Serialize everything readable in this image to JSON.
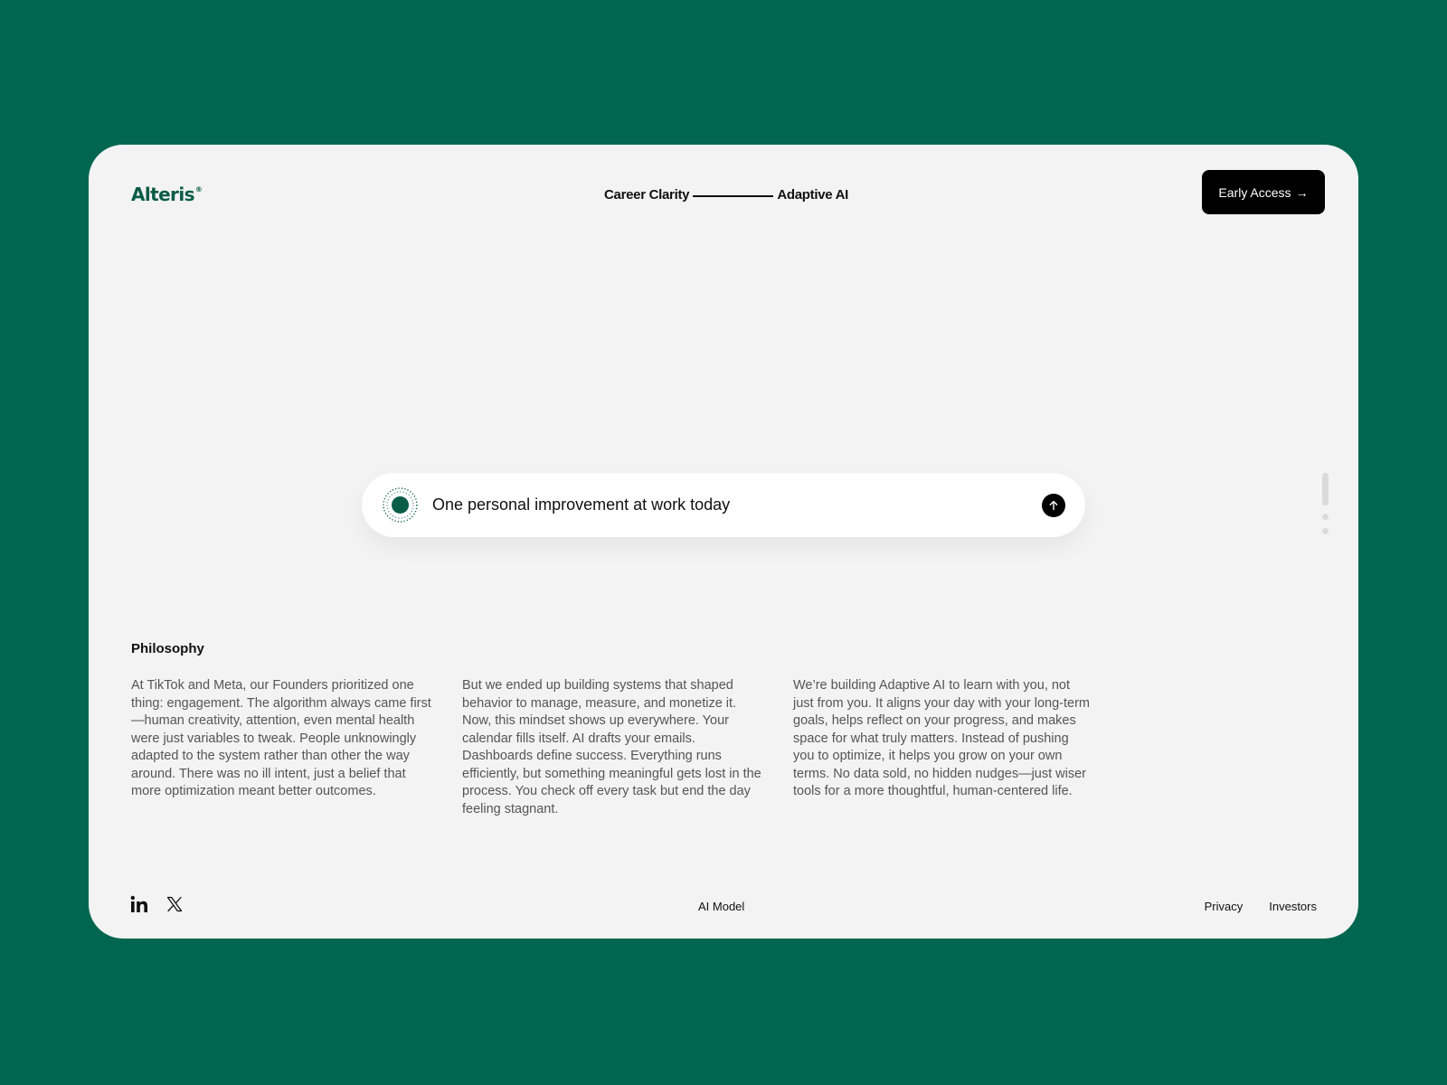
{
  "brand": {
    "name": "Alteris",
    "mark": "®",
    "color": "#0a5c46"
  },
  "header": {
    "tagline_left": "Career Clarity",
    "tagline_right": "Adaptive AI",
    "cta_label": "Early Access",
    "cta_arrow": "→"
  },
  "prompt": {
    "value": "One personal improvement at work today",
    "orb_icon": "pulse-orb-icon",
    "send_icon": "arrow-up-icon"
  },
  "pager": {
    "count": 3,
    "active": 1
  },
  "philosophy": {
    "title": "Philosophy",
    "paragraphs": [
      "At TikTok and Meta, our Founders prioritized one thing: engagement. The algorithm always came first—human creativity, attention, even mental health were just variables to tweak. People unknowingly adapted to the system rather than other the way around. There was no ill intent, just a belief that more optimization meant better outcomes.",
      "But we ended up building systems that shaped behavior to manage, measure, and monetize it. Now, this mindset shows up everywhere. Your calendar fills itself. AI drafts your emails. Dashboards define success. Everything runs efficiently, but something meaningful gets lost in the process. You check off every task but end the day feeling stagnant.",
      "We’re building Adaptive AI to learn with you, not just from you. It aligns your day with your long-term goals, helps reflect on your progress, and makes space for what truly matters. Instead of pushing you to optimize, it helps you grow on your own terms. No data sold, no hidden nudges—just wiser tools for a more thoughtful, human-centered life."
    ]
  },
  "footer": {
    "social_icons": [
      "linkedin-icon",
      "x-icon"
    ],
    "center_link": "AI Model",
    "links": [
      "Privacy",
      "Investors"
    ]
  },
  "colors": {
    "background": "#006650",
    "card": "#f3f3f3",
    "accent": "#0a5c46",
    "button": "#000000"
  }
}
